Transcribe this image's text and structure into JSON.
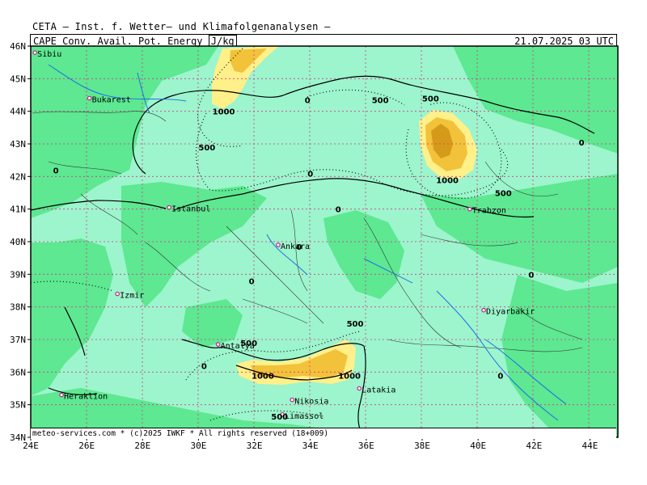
{
  "header": {
    "title": "CETA — Inst. f. Wetter— und Klimafolgenanalysen —",
    "parameter": "CAPE Conv. Avail. Pot. Energy",
    "unit": "J/kg",
    "valid_time": "21.07.2025 03 UTC"
  },
  "footer": {
    "credit": "meteo-services.com * (c)2025 IWKF * All rights reserved (18+009)"
  },
  "axes": {
    "lon_labels": [
      "24E",
      "26E",
      "28E",
      "30E",
      "32E",
      "34E",
      "36E",
      "38E",
      "40E",
      "42E",
      "44E"
    ],
    "lat_labels": [
      "46N",
      "45N",
      "44N",
      "43N",
      "42N",
      "41N",
      "40N",
      "39N",
      "38N",
      "37N",
      "36N",
      "35N",
      "34N"
    ]
  },
  "cities": [
    {
      "name": "Sibiu",
      "lon": 24.15,
      "lat": 45.8
    },
    {
      "name": "Bukarest",
      "lon": 26.1,
      "lat": 44.4
    },
    {
      "name": "Istanbul",
      "lon": 28.95,
      "lat": 41.05
    },
    {
      "name": "Izmir",
      "lon": 27.1,
      "lat": 38.4
    },
    {
      "name": "Ankara",
      "lon": 32.85,
      "lat": 39.9
    },
    {
      "name": "Trabzon",
      "lon": 39.7,
      "lat": 41.0
    },
    {
      "name": "Diyarbakir",
      "lon": 40.2,
      "lat": 37.9
    },
    {
      "name": "Antalya",
      "lon": 30.7,
      "lat": 36.85
    },
    {
      "name": "Heraklion",
      "lon": 25.1,
      "lat": 35.3
    },
    {
      "name": "Nikosia",
      "lon": 33.35,
      "lat": 35.15
    },
    {
      "name": "Limassol",
      "lon": 33.0,
      "lat": 34.7
    },
    {
      "name": "Latakia",
      "lon": 35.75,
      "lat": 35.5
    }
  ],
  "contour_labels": [
    {
      "text": "1000",
      "lon": 30.9,
      "lat": 43.9
    },
    {
      "text": "500",
      "lon": 30.3,
      "lat": 42.8
    },
    {
      "text": "0",
      "lon": 33.9,
      "lat": 44.25
    },
    {
      "text": "500",
      "lon": 36.5,
      "lat": 44.25
    },
    {
      "text": "500",
      "lon": 38.3,
      "lat": 44.3
    },
    {
      "text": "0",
      "lon": 43.7,
      "lat": 42.95
    },
    {
      "text": "0",
      "lon": 24.9,
      "lat": 42.1
    },
    {
      "text": "0",
      "lon": 34.0,
      "lat": 42.0
    },
    {
      "text": "1000",
      "lon": 38.9,
      "lat": 41.8
    },
    {
      "text": "500",
      "lon": 40.9,
      "lat": 41.4
    },
    {
      "text": "0",
      "lon": 35.0,
      "lat": 40.9
    },
    {
      "text": "0",
      "lon": 33.6,
      "lat": 39.75
    },
    {
      "text": "0",
      "lon": 31.9,
      "lat": 38.7
    },
    {
      "text": "0",
      "lon": 41.9,
      "lat": 38.9
    },
    {
      "text": "500",
      "lon": 35.6,
      "lat": 37.4
    },
    {
      "text": "500",
      "lon": 31.8,
      "lat": 36.8
    },
    {
      "text": "0",
      "lon": 30.2,
      "lat": 36.1
    },
    {
      "text": "1000",
      "lon": 32.3,
      "lat": 35.8
    },
    {
      "text": "1000",
      "lon": 35.4,
      "lat": 35.8
    },
    {
      "text": "0",
      "lon": 40.8,
      "lat": 35.8
    },
    {
      "text": "500",
      "lon": 32.9,
      "lat": 34.55
    }
  ],
  "legend_colors": {
    "cape_0": "#9cf5cc",
    "cape_low": "#5de891",
    "cape_500": "#fff08a",
    "cape_1000": "#f2c23a",
    "cape_1500": "#d69a1a"
  }
}
